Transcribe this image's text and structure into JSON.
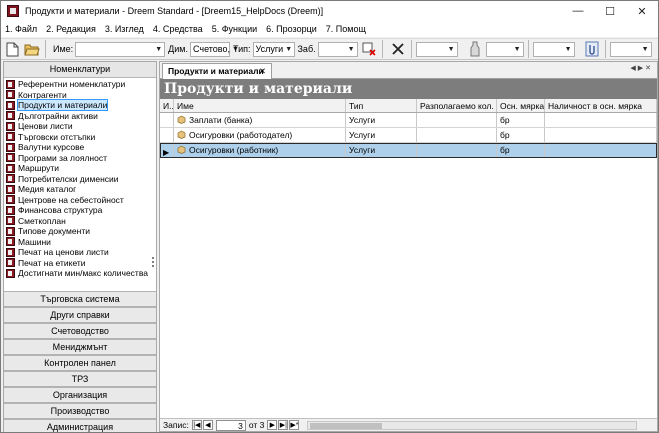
{
  "window": {
    "title": "Продукти и материали - Dreem Standard - [Dreem15_HelpDocs (Dreem)]",
    "minimize": "—",
    "maximize": "☐",
    "close": "✕"
  },
  "menu": [
    "1. Файл",
    "2. Редакция",
    "3. Изглед",
    "4. Средства",
    "5. Функции",
    "6. Прозорци",
    "7. Помощ"
  ],
  "toolbar": {
    "name_label": "Име:",
    "name_value": "",
    "dim_label": "Дим.",
    "dim_value": "Счетово,",
    "type_label": "Тип:",
    "type_value": "Услуги",
    "lock_label": "Заб.",
    "lock_value": ""
  },
  "sidebar": {
    "header": "Номенклатури",
    "items": [
      "Референтни номенклатури",
      "Контрагенти",
      "Продукти и материали",
      "Дълготрайни активи",
      "Ценови листи",
      "Търговски отстъпки",
      "Валутни курсове",
      "Програми за лоялност",
      "Маршрути",
      "Потребителски дименсии",
      "Медия каталог",
      "Центрове на себестойност",
      "Финансова структура",
      "Сметкоплан",
      "Типове документи",
      "Машини",
      "Печат на ценови листи",
      "Печат на етикети",
      "Достигнати мин/макс количества"
    ],
    "selected_index": 2,
    "categories": [
      "Търговска система",
      "Други справки",
      "Счетоводство",
      "Мениджмънт",
      "Контролен панел",
      "ТРЗ",
      "Организация",
      "Производство",
      "Администрация"
    ]
  },
  "main": {
    "tab_label": "Продукти и материали",
    "tab_close": "✕",
    "banner": "Продукти и материали",
    "columns": [
      "И...",
      "Име",
      "Тип",
      "Разполагаемо кол.",
      "Осн. мярка",
      "Наличност в осн. мярка"
    ],
    "rows": [
      {
        "name": "Заплати (банка)",
        "type": "Услуги",
        "available": "",
        "unit": "бр",
        "stock": ""
      },
      {
        "name": "Осигуровки (работодател)",
        "type": "Услуги",
        "available": "",
        "unit": "бр",
        "stock": ""
      },
      {
        "name": "Осигуровки (работник)",
        "type": "Услуги",
        "available": "",
        "unit": "бр",
        "stock": ""
      }
    ],
    "selected_row": 2
  },
  "status": {
    "record_label": "Запис:",
    "record_value": "3",
    "of_label": "от 3"
  },
  "colors": {
    "banner_bg": "#7d7d7d",
    "selected_row": "#aed0ea",
    "selected_item": "#cce8ff",
    "icon_red": "#8b1c24"
  }
}
